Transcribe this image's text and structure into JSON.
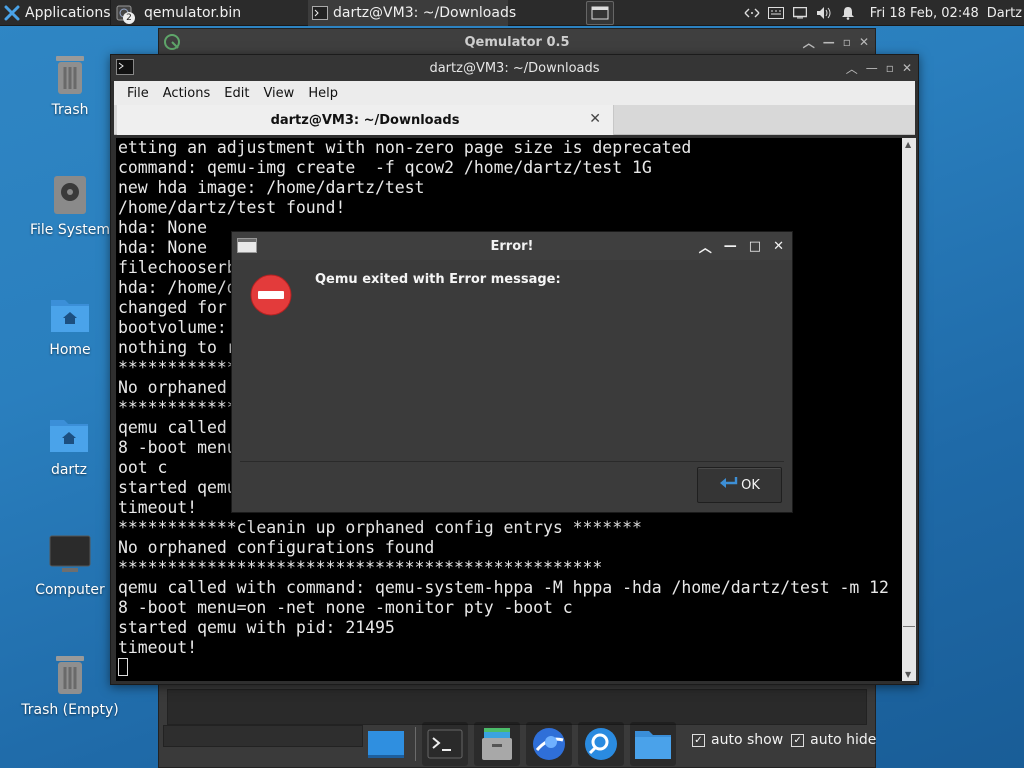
{
  "top_panel": {
    "applications_label": "Applications",
    "task1_label": "qemulator.bin",
    "task1_badge": "2",
    "task2_label": "dartz@VM3: ~/Downloads",
    "clock": "Fri 18 Feb, 02:48",
    "user": "Dartz",
    "icons": [
      "network-icon",
      "keyboard-icon",
      "display-icon",
      "volume-icon",
      "notifications-icon"
    ]
  },
  "desktop": {
    "icons": [
      {
        "label": "Trash",
        "icon": "trash-icon"
      },
      {
        "label": "File System",
        "icon": "drive-icon"
      },
      {
        "label": "Home",
        "icon": "home-folder-icon"
      },
      {
        "label": "dartz",
        "icon": "home-folder-icon"
      },
      {
        "label": "Computer",
        "icon": "monitor-icon"
      },
      {
        "label": "Trash (Empty)",
        "icon": "trash-icon"
      }
    ]
  },
  "qemulator": {
    "title": "Qemulator 0.5"
  },
  "terminal": {
    "title": "dartz@VM3: ~/Downloads",
    "menu": [
      "File",
      "Actions",
      "Edit",
      "View",
      "Help"
    ],
    "tab_label": "dartz@VM3: ~/Downloads",
    "lines": [
      "etting an adjustment with non-zero page size is deprecated",
      "command: qemu-img create  -f qcow2 /home/dartz/test 1G",
      "new hda image: /home/dartz/test",
      "/home/dartz/test found!",
      "hda: None",
      "hda: None",
      "filechooserb",
      "hda: /home/d",
      "changed for",
      "bootvolume:",
      "nothing to r",
      "************",
      "No orphaned",
      "************",
      "qemu called                                              /test -m 12",
      "8 -boot menu                                             itor pty -b",
      "oot c",
      "started qemu",
      "timeout!",
      "************cleanin up orphaned config entrys *******",
      "No orphaned configurations found",
      "*************************************************",
      "qemu called with command: qemu-system-hppa -M hppa -hda /home/dartz/test -m 12",
      "8 -boot menu=on -net none -monitor pty -boot c",
      "started qemu with pid: 21495",
      "timeout!"
    ]
  },
  "dialog": {
    "title": "Error!",
    "message": "Qemu exited with Error message:",
    "ok_label": "OK"
  },
  "dock": {
    "items": [
      "desktop-icon",
      "terminal-icon",
      "file-manager-icon",
      "web-browser-icon",
      "search-icon",
      "folder-icon"
    ],
    "auto_show_label": "auto show",
    "auto_hide_label": "auto hide"
  }
}
